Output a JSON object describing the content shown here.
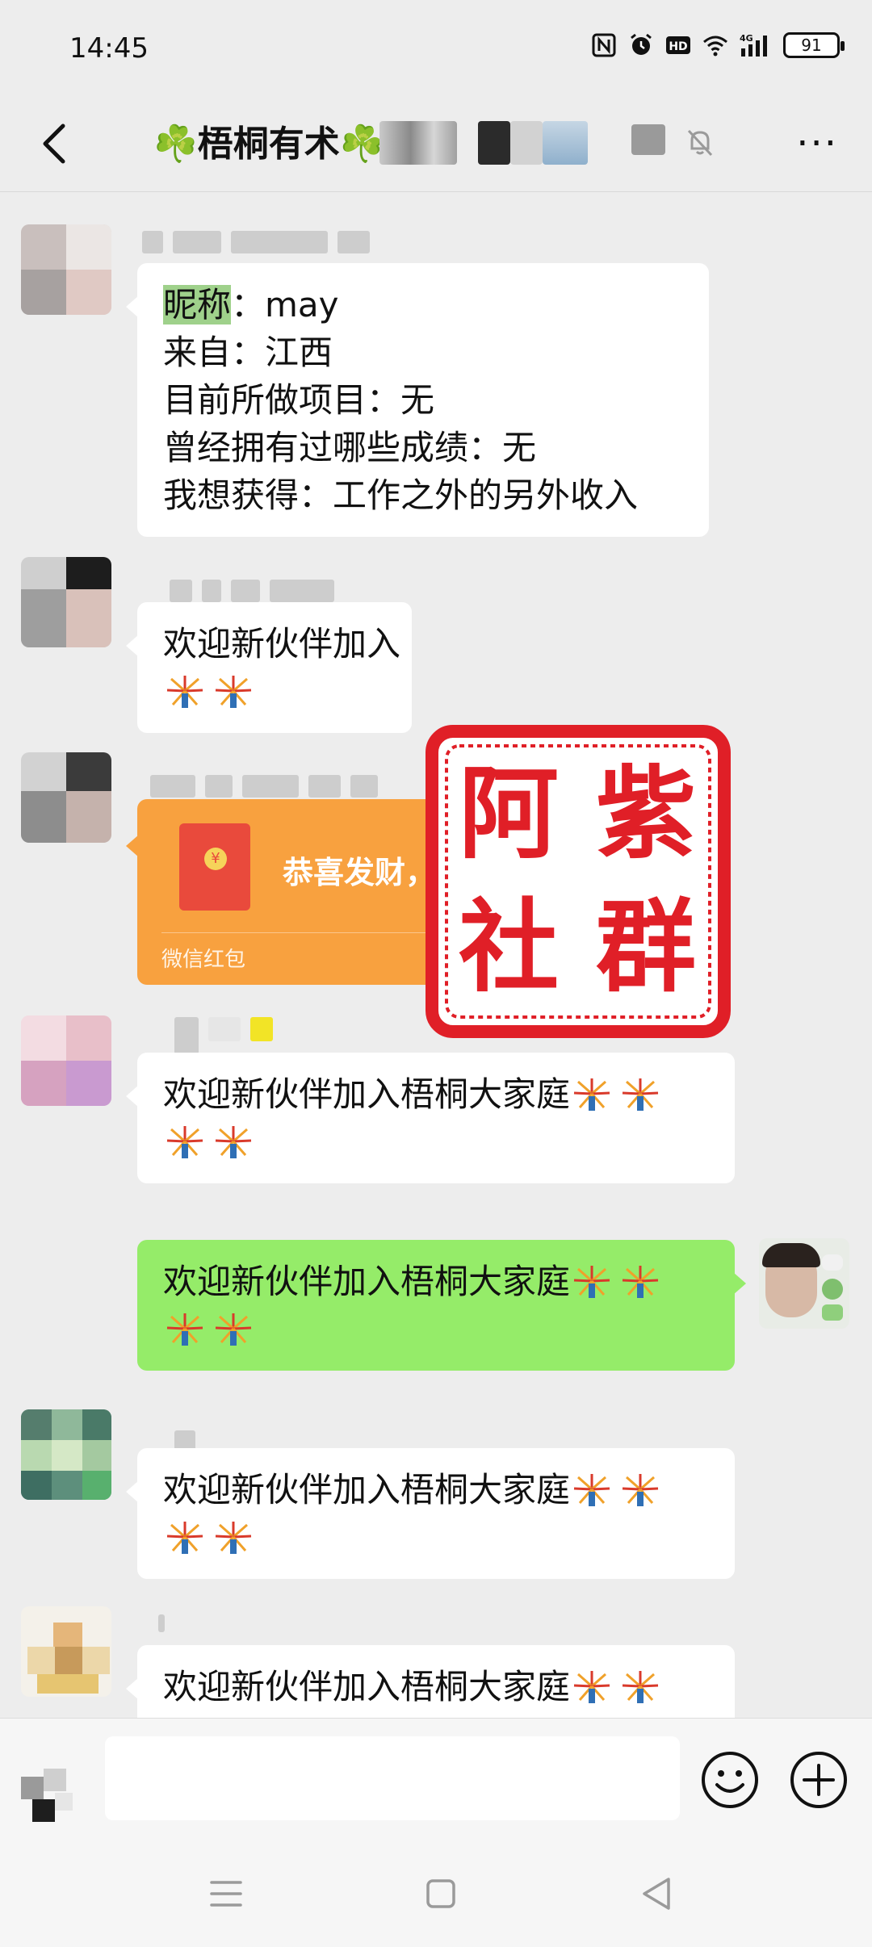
{
  "status_bar": {
    "time": "14:45",
    "battery_level": "91",
    "icons": [
      "nfc-icon",
      "alarm-icon",
      "hd-icon",
      "wifi-icon",
      "4g-signal-icon",
      "battery-icon"
    ]
  },
  "header": {
    "title": "☘️梧桐有术☘️",
    "icons": [
      "back-arrow-icon",
      "mute-bell-icon",
      "more-icon"
    ],
    "more_label": "···"
  },
  "messages": [
    {
      "type": "text",
      "side": "left",
      "lines": [
        {
          "highlight": "昵称",
          "text": "：may"
        },
        {
          "text": "来自：江西"
        },
        {
          "text": "目前所做项目：无"
        },
        {
          "text": "曾经拥有过哪些成绩：无"
        },
        {
          "text": "我想获得：工作之外的另外收入"
        }
      ]
    },
    {
      "type": "text",
      "side": "left",
      "text": "欢迎新伙伴加入",
      "emoji_line2": [
        "firework-icon",
        "firework-icon"
      ]
    },
    {
      "type": "red_packet",
      "side": "left",
      "greeting": "恭喜发财，大吉大利",
      "label": "微信红包"
    },
    {
      "type": "text",
      "side": "left",
      "text": "欢迎新伙伴加入梧桐大家庭",
      "emoji_line1": [
        "firework-icon",
        "firework-icon"
      ],
      "emoji_line2": [
        "firework-icon",
        "firework-icon"
      ]
    },
    {
      "type": "text",
      "side": "right",
      "text": "欢迎新伙伴加入梧桐大家庭",
      "emoji_line1": [
        "firework-icon",
        "firework-icon"
      ],
      "emoji_line2": [
        "firework-icon",
        "firework-icon"
      ]
    },
    {
      "type": "text",
      "side": "left",
      "text": "欢迎新伙伴加入梧桐大家庭",
      "emoji_line1": [
        "firework-icon",
        "firework-icon"
      ],
      "emoji_line2": [
        "firework-icon",
        "firework-icon"
      ]
    },
    {
      "type": "text",
      "side": "left",
      "text": "欢迎新伙伴加入梧桐大家庭",
      "emoji_line1": [
        "firework-icon",
        "firework-icon"
      ]
    }
  ],
  "watermark": {
    "text": "阿紫社群",
    "color": "#e01f27"
  },
  "input_bar": {
    "value": "",
    "icons": [
      "voice-toggle-icon",
      "emoji-icon",
      "plus-icon"
    ]
  },
  "nav_bar": {
    "icons": [
      "menu-icon",
      "home-icon",
      "back-triangle-icon"
    ]
  },
  "colors": {
    "background": "#ededed",
    "bubble_left": "#ffffff",
    "bubble_self": "#95ec69",
    "red_packet": "#f8a13f",
    "highlight": "#9fd18b"
  }
}
